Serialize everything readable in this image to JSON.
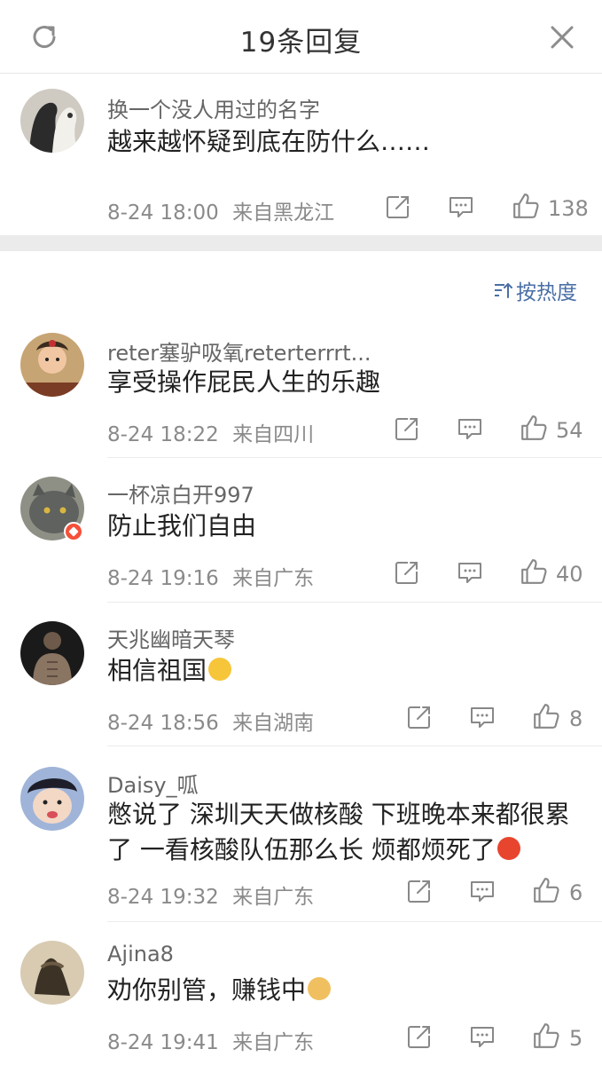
{
  "header": {
    "title": "19条回复",
    "refresh_icon": "refresh-icon",
    "close_icon": "close-icon"
  },
  "main_comment": {
    "username": "换一个没人用过的名字",
    "text": "越来越怀疑到底在防什么……",
    "time": "8-24 18:00",
    "location": "来自黑龙江",
    "likes": "138"
  },
  "sort": {
    "label": "按热度",
    "icon": "sort-icon"
  },
  "replies": [
    {
      "username": "reter塞驴吸氧reterterrrt...",
      "text": "享受操作屁民人生的乐趣",
      "time": "8-24 18:22",
      "location": "来自四川",
      "likes": "54"
    },
    {
      "username": "一杯凉白开997",
      "text": "防止我们自由",
      "time": "8-24 19:16",
      "location": "来自广东",
      "likes": "40"
    },
    {
      "username": "天兆幽暗天琴",
      "text": "相信祖国",
      "time": "8-24 18:56",
      "location": "来自湖南",
      "likes": "8"
    },
    {
      "username": "Daisy_呱",
      "text": "憋说了 深圳天天做核酸 下班晚本来都很累了 一看核酸队伍那么长 烦都烦死了",
      "time": "8-24 19:32",
      "location": "来自广东",
      "likes": "6"
    },
    {
      "username": "Ajina8",
      "text": "劝你别管，赚钱中",
      "time": "8-24 19:41",
      "location": "来自广东",
      "likes": "5"
    }
  ],
  "colors": {
    "accent": "#4a6fa6",
    "badge": "#f5503a",
    "meta": "#8a8a8a"
  }
}
